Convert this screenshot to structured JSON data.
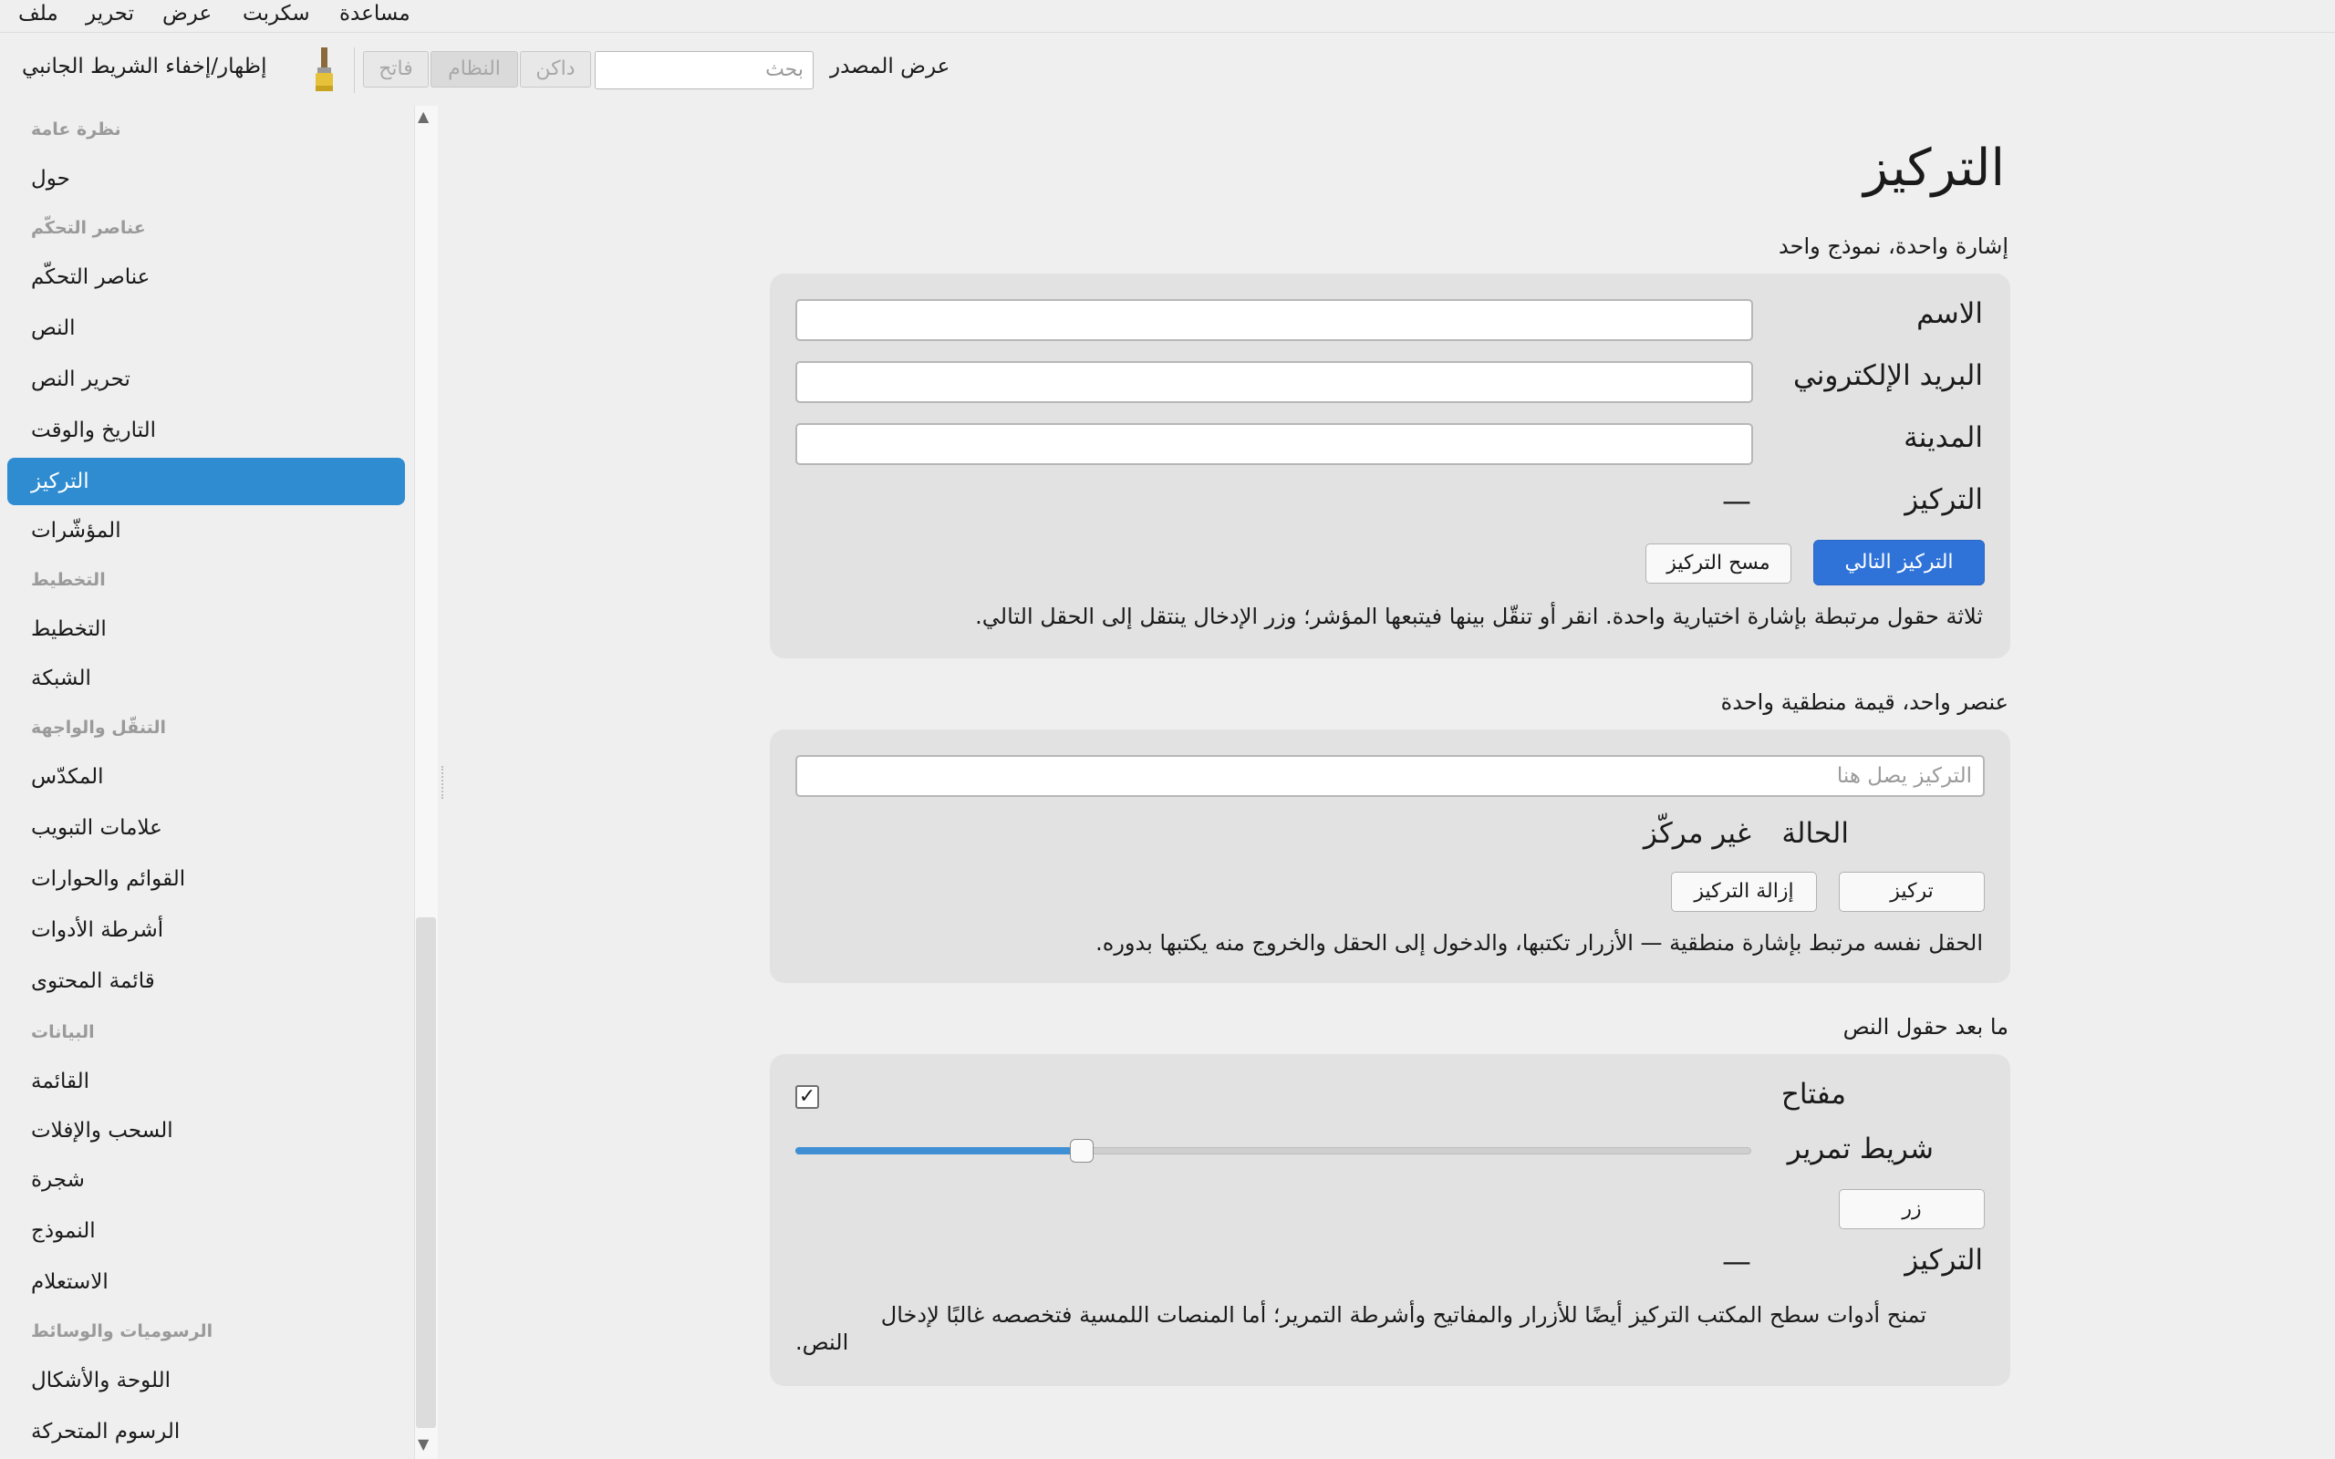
{
  "menubar": {
    "items": [
      "ملف",
      "تحرير",
      "عرض",
      "سكربت",
      "مساعدة"
    ]
  },
  "toolbar": {
    "toggle_sidebar_label": "إظهار/إخفاء الشريط الجانبي",
    "light_label": "فاتح",
    "system_label": "النظام",
    "dark_label": "داكن",
    "search_placeholder": "بحث",
    "view_source_label": "عرض المصدر",
    "icon": "paintbrush-icon"
  },
  "sidebar": {
    "items": [
      {
        "label": "نظرة عامة",
        "type": "header"
      },
      {
        "label": "حول",
        "type": "item"
      },
      {
        "label": "عناصر التحكّم",
        "type": "header"
      },
      {
        "label": "عناصر التحكّم",
        "type": "item"
      },
      {
        "label": "النص",
        "type": "item"
      },
      {
        "label": "تحرير النص",
        "type": "item"
      },
      {
        "label": "التاريخ والوقت",
        "type": "item"
      },
      {
        "label": "التركيز",
        "type": "item",
        "selected": true
      },
      {
        "label": "المؤشّرات",
        "type": "item"
      },
      {
        "label": "التخطيط",
        "type": "header"
      },
      {
        "label": "التخطيط",
        "type": "item"
      },
      {
        "label": "الشبكة",
        "type": "item"
      },
      {
        "label": "التنقّل والواجهة",
        "type": "header"
      },
      {
        "label": "المكدّس",
        "type": "item"
      },
      {
        "label": "علامات التبويب",
        "type": "item"
      },
      {
        "label": "القوائم والحوارات",
        "type": "item"
      },
      {
        "label": "أشرطة الأدوات",
        "type": "item"
      },
      {
        "label": "قائمة المحتوى",
        "type": "item"
      },
      {
        "label": "البيانات",
        "type": "header"
      },
      {
        "label": "القائمة",
        "type": "item"
      },
      {
        "label": "السحب والإفلات",
        "type": "item"
      },
      {
        "label": "شجرة",
        "type": "item"
      },
      {
        "label": "النموذج",
        "type": "item"
      },
      {
        "label": "الاستعلام",
        "type": "item"
      },
      {
        "label": "الرسوميات والوسائط",
        "type": "header"
      },
      {
        "label": "اللوحة والأشكال",
        "type": "item"
      },
      {
        "label": "الرسوم المتحركة",
        "type": "item"
      }
    ]
  },
  "main": {
    "title": "التركيز",
    "section1": {
      "title": "إشارة واحدة، نموذج واحد",
      "name_label": "الاسم",
      "email_label": "البريد الإلكتروني",
      "city_label": "المدينة",
      "focus_label": "التركيز",
      "focus_value": "—",
      "next_focus_button": "التركيز التالي",
      "clear_focus_button": "مسح التركيز",
      "description": "ثلاثة حقول مرتبطة بإشارة اختيارية واحدة. انقر أو تنقّل بينها فيتبعها المؤشر؛ وزر الإدخال ينتقل إلى الحقل التالي."
    },
    "section2": {
      "title": "عنصر واحد، قيمة منطقية واحدة",
      "input_placeholder": "التركيز يصل هنا",
      "state_label": "الحالة",
      "state_value": "غير مركّز",
      "focus_button": "تركيز",
      "unfocus_button": "إزالة التركيز",
      "description": "الحقل نفسه مرتبط بإشارة منطقية — الأزرار تكتبها، والدخول إلى الحقل والخروج منه يكتبها بدوره."
    },
    "section3": {
      "title": "ما بعد حقول النص",
      "switch_label": "مفتاح",
      "switch_checked": true,
      "slider_label": "شريط تمرير",
      "slider_value": 0.3,
      "button_label": "زر",
      "focus_label": "التركيز",
      "focus_value": "—",
      "description_line1": "تمنح أدوات سطح المكتب التركيز أيضًا للأزرار والمفاتيح وأشرطة التمرير؛ أما المنصات اللمسية فتخصصه غالبًا لإدخال",
      "description_line2": "النص."
    }
  }
}
